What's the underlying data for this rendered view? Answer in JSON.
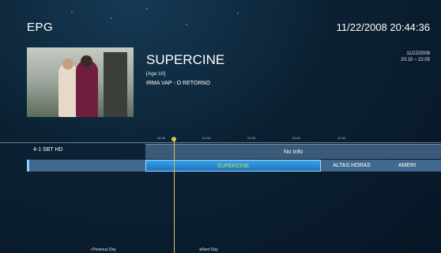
{
  "header": {
    "title": "EPG",
    "datetime": "11/22/2008 20:44:36"
  },
  "program": {
    "channel": "SUPERCINE",
    "age": "[Age:10]",
    "name": "IRMA VAP - O RETORNO",
    "date": "11/22/2008",
    "time_range": "20:10 ~ 22:05"
  },
  "timeline": {
    "ticks": [
      "20:30",
      "21:00",
      "21:30",
      "22:00",
      "22:30"
    ]
  },
  "rows": [
    {
      "label": "4-1  SBT HD",
      "programs": [
        "No Info"
      ]
    },
    {
      "label": "",
      "programs": [
        "SUPERCINE",
        "ALTAS HORAS",
        "AMERI"
      ]
    }
  ],
  "footer": {
    "prev": "Previous Day",
    "next": "Next Day"
  },
  "colors": {
    "background": "#0b2133",
    "selected": "#1b73bd",
    "selected_text": "#b7e64a",
    "now_line": "#d6c35a",
    "prev_key": "#e33333",
    "next_key": "#f0d24a"
  }
}
